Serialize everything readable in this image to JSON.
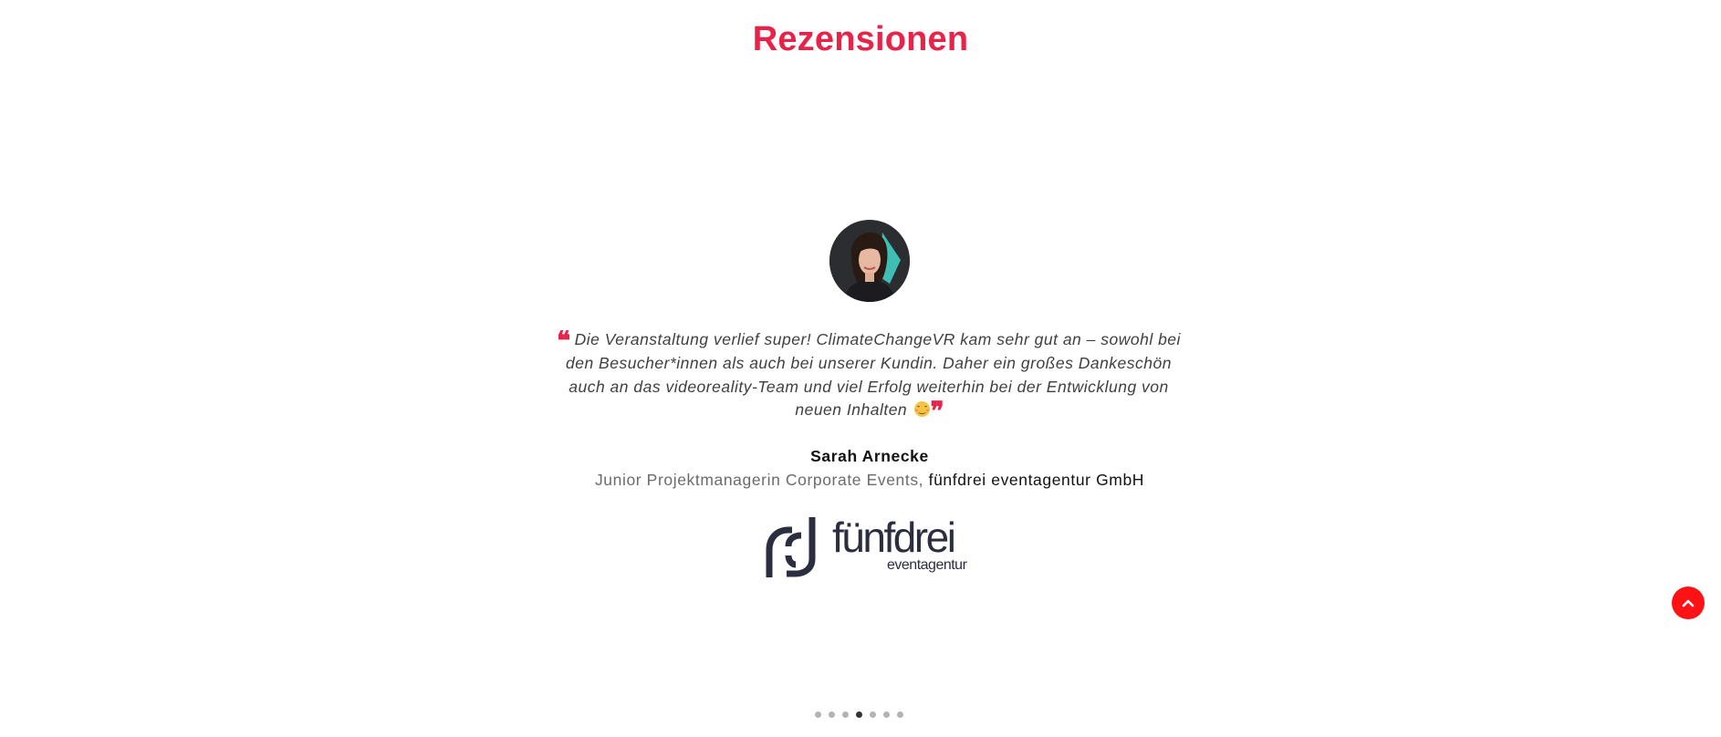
{
  "section": {
    "title": "Rezensionen"
  },
  "testimonial": {
    "avatar_icon": "avatar-photo",
    "quote_open": "❝",
    "quote_text": "Die Veranstaltung verlief super! ClimateChangeVR kam sehr gut an – sowohl bei den Besucher*innen als auch bei unserer Kundin. Daher ein großes Dankeschön auch an das videoreality-Team und viel Erfolg weiterhin bei der Entwicklung von neuen Inhalten",
    "emoji_icon": "smiling-face-emoji",
    "quote_close": "❞",
    "author_name": "Sarah Arnecke",
    "author_role": "Junior Projektmanagerin Corporate Events,",
    "author_company": "fünfdrei eventagentur GmbH",
    "logo_word": "fünfdrei",
    "logo_sub": "eventagentur"
  },
  "scroll_top": {
    "icon": "chevron-up-icon"
  },
  "slider": {
    "dots": [
      {
        "active": false
      },
      {
        "active": false
      },
      {
        "active": false
      },
      {
        "active": true
      },
      {
        "active": false
      },
      {
        "active": false
      },
      {
        "active": false
      }
    ]
  },
  "colors": {
    "accent": "#e8234a",
    "scroll_button": "#ff1216",
    "logo": "#2b2e3f"
  }
}
